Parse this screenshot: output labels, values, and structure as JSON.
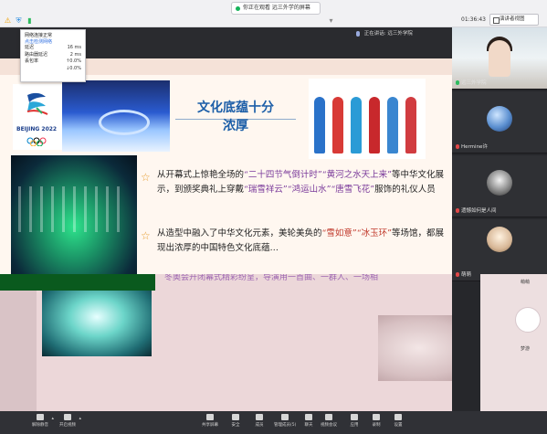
{
  "topbar": {
    "share_banner": "你正在观看 远三外学的屏幕",
    "timer": "01:36:43",
    "view_button": "演讲者视图"
  },
  "darkstrip": {
    "speaking_label": "正在讲话: 远三外学院"
  },
  "network_popup": {
    "status": "网络连接正常",
    "detect_link": "点击检测网络",
    "rows": [
      {
        "label": "延迟",
        "value": "16 ms"
      },
      {
        "label": "路由器延迟",
        "value": "2 ms"
      },
      {
        "label": "丢包率",
        "value": "↑0.0%"
      },
      {
        "label": "",
        "value": "↓0.0%"
      }
    ]
  },
  "slide": {
    "logo_text": "BEIJING 2022",
    "title_line1": "文化底蕴十分",
    "title_line2": "浓厚",
    "para1_a": "从开幕式上惊艳全场的",
    "para1_b": "“二十四节气倒计时”",
    "para1_c": "“黄河之水天上来”",
    "para1_d": "等中华",
    "para1_e": "文化展示，到颁奖典礼上穿戴",
    "para1_f": "“瑞雪祥云”",
    "para1_g": "“鸿运山水”",
    "para1_h": "“唐雪飞花”",
    "para1_i": "服饰",
    "para1_j": "的礼仪人员",
    "para2_a": "从造型中融入了中华文化元素，美轮美奂的",
    "para2_b": "“雪如意”",
    "para2_c": "“冰玉环”",
    "para2_d": "等场",
    "para2_e": "馆，都展现出浓厚的中国特色文化底蕴…",
    "distorted_line": "冬奥会开闭幕式精彩纷呈，导演用一首曲、一群人、一场相"
  },
  "participants": [
    {
      "name": "远三外学院",
      "mic": "on"
    },
    {
      "name": "Hermine许",
      "mic": "off"
    },
    {
      "name": "遗憾如何是人间",
      "mic": "off"
    },
    {
      "name": "萌萌",
      "mic": "off"
    }
  ],
  "right_lower": {
    "label_top": "萌萌",
    "label_mid": "梦游"
  },
  "toolbar": {
    "items": [
      {
        "label": "解除静音",
        "caret": true
      },
      {
        "label": "开启视频",
        "caret": true
      },
      {
        "label": "共享屏幕",
        "caret": false
      },
      {
        "label": "安全",
        "caret": false
      },
      {
        "label": "成员",
        "caret": false
      },
      {
        "label": "管理成员(5)",
        "caret": false
      },
      {
        "label": "聊天",
        "caret": false
      },
      {
        "label": "视频会议",
        "caret": false
      },
      {
        "label": "应用",
        "caret": false
      },
      {
        "label": "录制",
        "caret": false
      },
      {
        "label": "设置",
        "caret": false
      }
    ]
  },
  "colors": {
    "accent_blue": "#1d5fa8",
    "highlight_red": "#c0392b",
    "highlight_purple": "#7a3a9a",
    "mic_on": "#2dbb5e",
    "mic_off": "#e04848"
  }
}
